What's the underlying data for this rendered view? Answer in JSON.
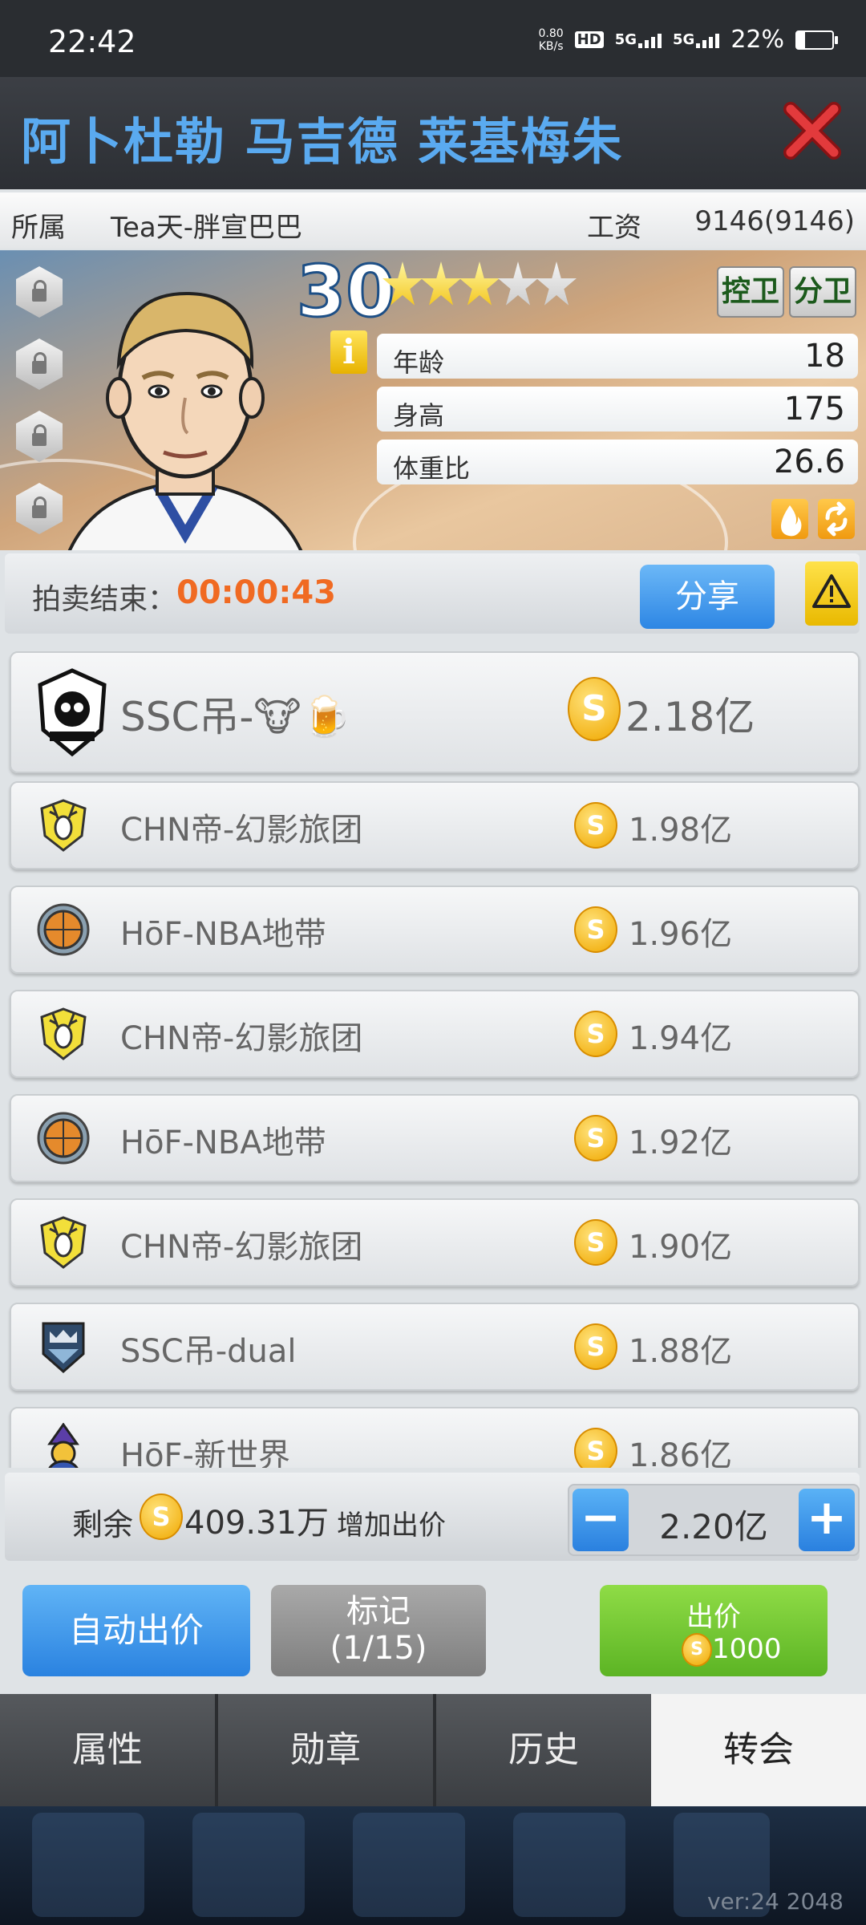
{
  "status_bar": {
    "time": "22:42",
    "net_speed_value": "0.80",
    "net_speed_unit": "KB/s",
    "hd_label": "HD",
    "sim1_label": "5G",
    "sim2_label": "5G",
    "battery_text": "22%"
  },
  "header": {
    "player_name": "阿卜杜勒 马吉德 莱基梅朱",
    "close_icon": "close-x-icon"
  },
  "info_row": {
    "team_label": "所属",
    "team_value": "Tea天-胖宣巴巴",
    "salary_label": "工资",
    "salary_value": "9146(9146)"
  },
  "player": {
    "level": "30",
    "stars_total": 5,
    "stars_filled": 3,
    "positions": [
      "控卫",
      "分卫"
    ],
    "info_icon": "i",
    "stats": [
      {
        "key": "年龄",
        "value": "18"
      },
      {
        "key": "身高",
        "value": "175"
      },
      {
        "key": "体重比",
        "value": "26.6"
      }
    ],
    "locked_slots": 4
  },
  "auction": {
    "end_label": "拍卖结束：",
    "countdown": "00:00:43",
    "share_label": "分享",
    "warning_icon": "warning-triangle-icon"
  },
  "bids": [
    {
      "team": "SSC吊-🐮🍺",
      "amount": "2.18亿",
      "logo": "skull-crest-logo"
    },
    {
      "team": "CHN帝-幻影旅团",
      "amount": "1.98亿",
      "logo": "deer-shield-logo"
    },
    {
      "team": "HōF-NBA地带",
      "amount": "1.96亿",
      "logo": "basketball-logo"
    },
    {
      "team": "CHN帝-幻影旅团",
      "amount": "1.94亿",
      "logo": "deer-shield-logo"
    },
    {
      "team": "HōF-NBA地带",
      "amount": "1.92亿",
      "logo": "basketball-logo"
    },
    {
      "team": "CHN帝-幻影旅团",
      "amount": "1.90亿",
      "logo": "deer-shield-logo"
    },
    {
      "team": "SSC吊-dual",
      "amount": "1.88亿",
      "logo": "crown-shield-logo"
    },
    {
      "team": "HōF-新世界",
      "amount": "1.86亿",
      "logo": "wizard-logo"
    }
  ],
  "bid_controls": {
    "remaining_label": "剩余",
    "remaining_value": "409.31万",
    "increase_label": "增加出价",
    "bid_value": "2.20亿",
    "minus": "−",
    "plus": "+"
  },
  "actions": {
    "auto_bid": "自动出价",
    "mark_line1": "标记",
    "mark_line2": "(1/15)",
    "bid_label": "出价",
    "bid_cost": "1000"
  },
  "tabs": [
    {
      "label": "属性",
      "active": false
    },
    {
      "label": "勋章",
      "active": false
    },
    {
      "label": "历史",
      "active": false
    },
    {
      "label": "转会",
      "active": true
    }
  ],
  "footer": {
    "version": "ver:24  2048"
  },
  "colors": {
    "title_blue": "#5aaaf0",
    "countdown_orange": "#f06a22",
    "close_red": "#d8262a",
    "bid_green": "#6cc32e",
    "button_blue": "#3a90e8"
  }
}
